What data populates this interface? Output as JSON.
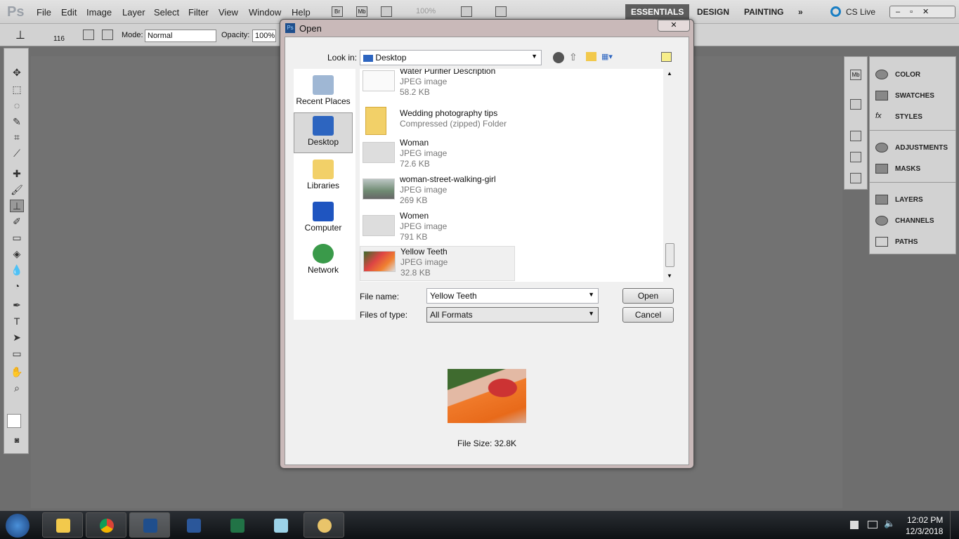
{
  "app": {
    "logo": "Ps",
    "menus": [
      "File",
      "Edit",
      "Image",
      "Layer",
      "Select",
      "Filter",
      "View",
      "Window",
      "Help"
    ],
    "appbar": {
      "bridge": "Br",
      "minibridge": "Mb",
      "zoom": "100%"
    },
    "workspaces": [
      "ESSENTIALS",
      "DESIGN",
      "PAINTING"
    ],
    "active_workspace": "ESSENTIALS",
    "cs_live": "CS Live"
  },
  "options": {
    "brush_size": "116",
    "mode_label": "Mode:",
    "mode_value": "Normal",
    "opacity_label": "Opacity:",
    "opacity_value": "100%"
  },
  "panels": {
    "group1": [
      "COLOR",
      "SWATCHES",
      "STYLES"
    ],
    "group2": [
      "ADJUSTMENTS",
      "MASKS"
    ],
    "group3": [
      "LAYERS",
      "CHANNELS",
      "PATHS"
    ]
  },
  "dialog": {
    "title": "Open",
    "look_in_label": "Look in:",
    "look_in_value": "Desktop",
    "places": [
      "Recent Places",
      "Desktop",
      "Libraries",
      "Computer",
      "Network"
    ],
    "selected_place": "Desktop",
    "files": [
      {
        "name": "Water Purifier Description",
        "type": "JPEG image",
        "size": "58.2 KB"
      },
      {
        "name": "Wedding photography tips",
        "type": "Compressed (zipped) Folder",
        "size": ""
      },
      {
        "name": "Woman",
        "type": "JPEG image",
        "size": "72.6 KB"
      },
      {
        "name": "woman-street-walking-girl",
        "type": "JPEG image",
        "size": "269 KB"
      },
      {
        "name": "Women",
        "type": "JPEG image",
        "size": "791 KB"
      },
      {
        "name": "Yellow Teeth",
        "type": "JPEG image",
        "size": "32.8 KB"
      }
    ],
    "selected_file": "Yellow Teeth",
    "file_name_label": "File name:",
    "file_name_value": "Yellow Teeth",
    "file_type_label": "Files of type:",
    "file_type_value": "All Formats",
    "open_label": "Open",
    "cancel_label": "Cancel",
    "file_size": "File Size: 32.8K"
  },
  "taskbar": {
    "time": "12:02 PM",
    "date": "12/3/2018"
  }
}
